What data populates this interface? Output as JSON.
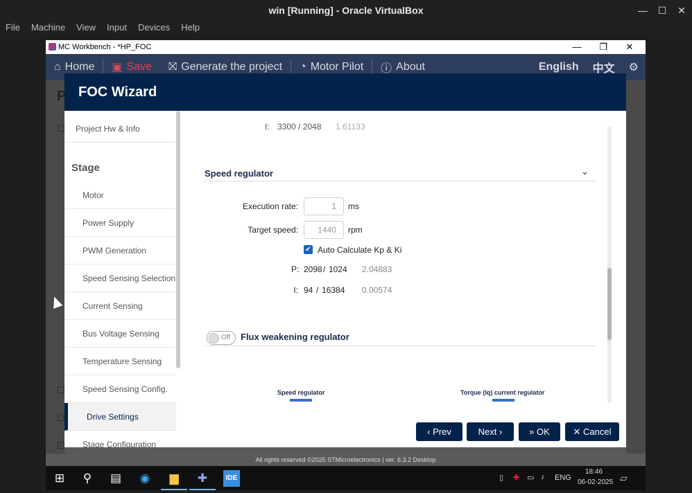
{
  "host": {
    "title": "win [Running] - Oracle VirtualBox",
    "menu": [
      "File",
      "Machine",
      "View",
      "Input",
      "Devices",
      "Help"
    ]
  },
  "mc": {
    "title": "MC Workbench - *HP_FOC",
    "nav": {
      "home": "Home",
      "save": "Save",
      "generate": "Generate the project",
      "motor_pilot": "Motor Pilot",
      "about": "About",
      "lang_en": "English",
      "lang_zh": "中文"
    },
    "footer": "All rights reserved ©2025 STMicroelectronics | ver. 6.3.2 Desktop"
  },
  "wizard": {
    "title": "FOC Wizard",
    "sidebar": {
      "project": "Project Hw & Info",
      "stage_heading": "Stage",
      "items": [
        "Motor",
        "Power Supply",
        "PWM Generation",
        "Speed Sensing Selection",
        "Current Sensing",
        "Bus Voltage Sensing",
        "Temperature Sensing",
        "Speed Sensing Config.",
        "Drive Settings",
        "Stage Configuration"
      ],
      "active_index": 8
    },
    "top_row": {
      "label": "I:",
      "ratio": "3300 / 2048",
      "value": "1.61133"
    },
    "speed_regulator": {
      "title": "Speed regulator",
      "execution_rate_label": "Execution rate:",
      "execution_rate_value": "1",
      "execution_rate_unit": "ms",
      "target_speed_label": "Target speed:",
      "target_speed_value": "1440",
      "target_speed_unit": "rpm",
      "auto_calc_label": "Auto Calculate Kp & Ki",
      "auto_calc_checked": true,
      "p_label": "P:",
      "p_num": "2098",
      "p_den": "1024",
      "p_value": "2.04883",
      "i_label": "I:",
      "i_num": "94",
      "i_den": "16384",
      "i_value": "0.00574"
    },
    "flux": {
      "title": "Flux weakening regulator",
      "toggle_text": "Off",
      "enabled": false
    },
    "diagram": {
      "speed_label": "Speed regulator",
      "torque_label": "Torque (Iq) current regulator"
    },
    "buttons": {
      "prev": "Prev",
      "next": "Next",
      "ok": "OK",
      "cancel": "Cancel"
    }
  },
  "taskbar": {
    "lang": "ENG",
    "time": "18:46",
    "date": "06-02-2025"
  },
  "colors": {
    "nav_bg": "#2d3d5c",
    "modal_head": "#03234b",
    "save_red": "#e0445a",
    "accent_blue": "#3b6fc4"
  }
}
